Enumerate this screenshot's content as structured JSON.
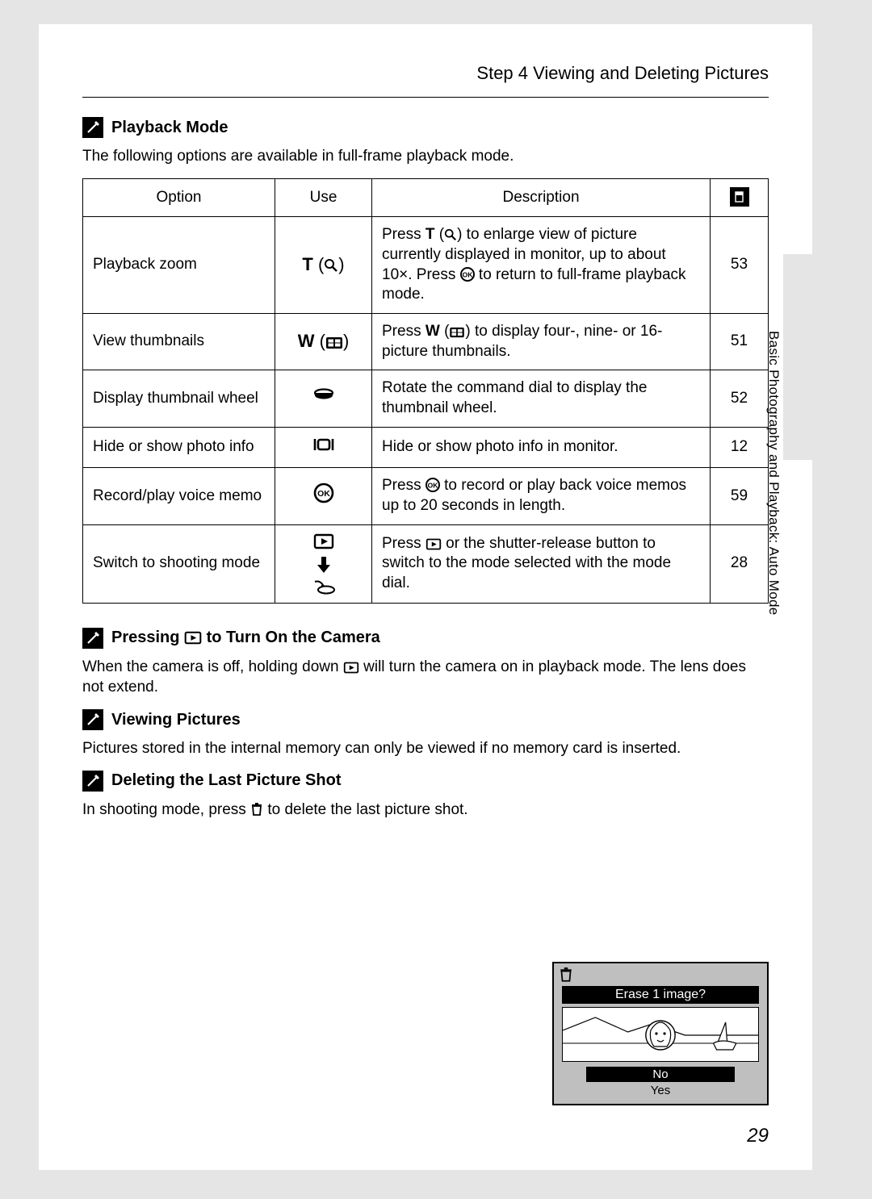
{
  "step_title": "Step 4 Viewing and Deleting Pictures",
  "side_label": "Basic Photography and Playback: Auto Mode",
  "page_number": "29",
  "playback": {
    "title": "Playback Mode",
    "intro": "The following options are available in full-frame playback mode.",
    "headers": {
      "option": "Option",
      "use": "Use",
      "description": "Description"
    },
    "rows": [
      {
        "option": "Playback zoom",
        "use_label": "T",
        "desc_pre": "Press ",
        "desc_mid_bold": "T",
        "desc_mid2": " (",
        "desc_mid3": ") to enlarge view of picture currently displayed in monitor, up to about 10×. Press ",
        "desc_post": " to return to full-frame playback mode.",
        "ref": "53"
      },
      {
        "option": "View thumbnails",
        "use_label": "W",
        "desc_pre": "Press ",
        "desc_mid_bold": "W",
        "desc_mid2": " (",
        "desc_mid3": ") to display four-, nine- or 16- picture thumbnails.",
        "ref": "51"
      },
      {
        "option": "Display thumbnail wheel",
        "desc": "Rotate the command dial to display the thumbnail wheel.",
        "ref": "52"
      },
      {
        "option": "Hide or show photo info",
        "desc": "Hide or show photo info in monitor.",
        "ref": "12"
      },
      {
        "option": "Record/play voice memo",
        "desc_pre": "Press ",
        "desc_post": " to record or play back voice memos up to 20 seconds in length.",
        "ref": "59"
      },
      {
        "option": "Switch to shooting mode",
        "desc_pre": "Press ",
        "desc_post": " or the shutter-release button to switch to the mode selected with the mode dial.",
        "ref": "28"
      }
    ]
  },
  "pressing": {
    "title_pre": "Pressing ",
    "title_post": " to Turn On the Camera",
    "body_pre": "When the camera is off, holding down ",
    "body_post": " will turn the camera on in playback mode. The lens does not extend."
  },
  "viewing": {
    "title": "Viewing Pictures",
    "body": "Pictures stored in the internal memory can only be viewed if no memory card is inserted."
  },
  "deleting": {
    "title": "Deleting the Last Picture Shot",
    "body_pre": "In shooting mode, press ",
    "body_post": " to delete the last picture shot."
  },
  "lcd": {
    "prompt": "Erase 1 image?",
    "no": "No",
    "yes": "Yes"
  }
}
